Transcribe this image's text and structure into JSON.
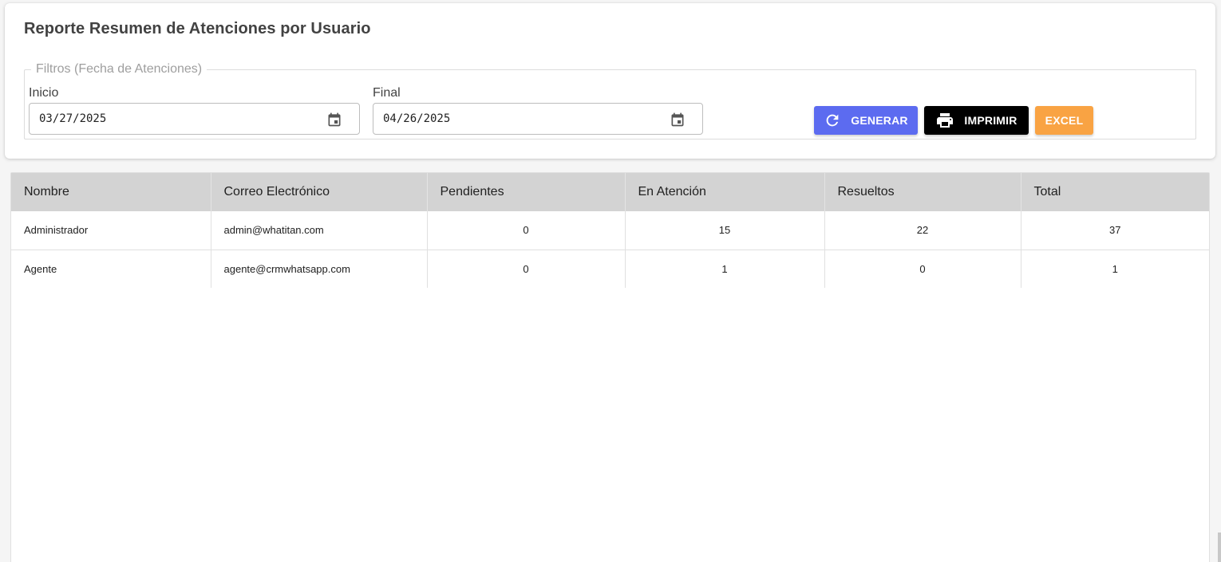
{
  "header": {
    "title": "Reporte Resumen de Atenciones por Usuario"
  },
  "filters": {
    "legend": "Filtros (Fecha de Atenciones)",
    "start": {
      "label": "Inicio",
      "value": "03/27/2025",
      "icon": "calendar-icon"
    },
    "end": {
      "label": "Final",
      "value": "04/26/2025",
      "icon": "calendar-icon"
    }
  },
  "actions": {
    "generar": {
      "label": "GENERAR",
      "icon": "refresh-icon",
      "color": "#5c6bf0"
    },
    "imprimir": {
      "label": "IMPRIMIR",
      "icon": "printer-icon",
      "color": "#000000"
    },
    "excel": {
      "label": "EXCEL",
      "color": "#f9a343"
    }
  },
  "table": {
    "columns": [
      "Nombre",
      "Correo Electrónico",
      "Pendientes",
      "En Atención",
      "Resueltos",
      "Total"
    ],
    "rows": [
      {
        "nombre": "Administrador",
        "correo": "admin@whatitan.com",
        "pendientes": "0",
        "en_atencion": "15",
        "resueltos": "22",
        "total": "37"
      },
      {
        "nombre": "Agente",
        "correo": "agente@crmwhatsapp.com",
        "pendientes": "0",
        "en_atencion": "1",
        "resueltos": "0",
        "total": "1"
      }
    ]
  }
}
